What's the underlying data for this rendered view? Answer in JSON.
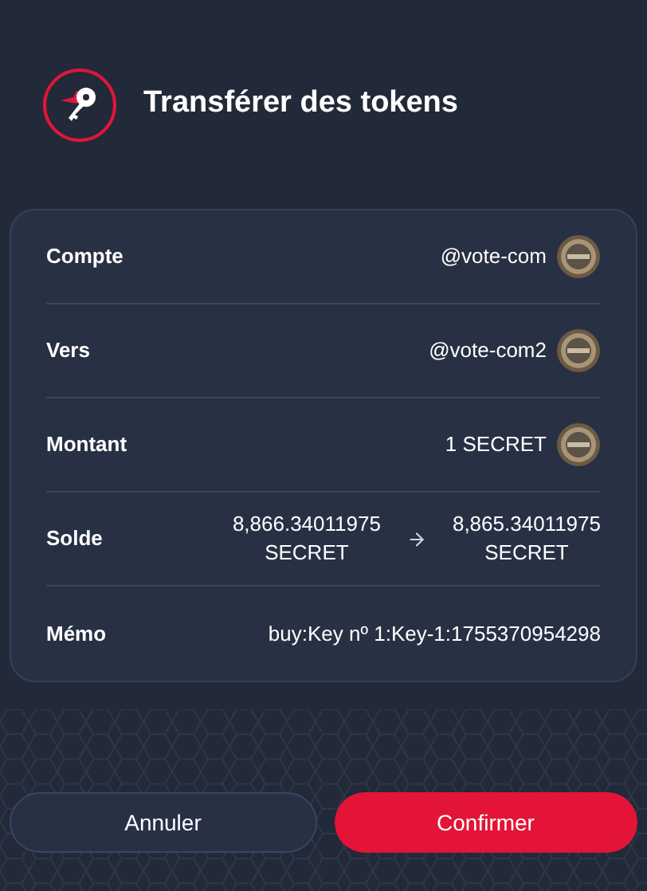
{
  "header": {
    "title": "Transférer des tokens"
  },
  "rows": [
    {
      "kind": "account",
      "label": "Compte",
      "value": "@vote-com"
    },
    {
      "kind": "account",
      "label": "Vers",
      "value": "@vote-com2"
    },
    {
      "kind": "account",
      "label": "Montant",
      "value": "1 SECRET"
    },
    {
      "kind": "balance",
      "label": "Solde",
      "from": {
        "amount": "8,866.34011975",
        "unit": "SECRET"
      },
      "to": {
        "amount": "8,865.34011975",
        "unit": "SECRET"
      }
    },
    {
      "kind": "text",
      "label": "Mémo",
      "value": "buy:Key nº 1:Key-1:1755370954298"
    }
  ],
  "buttons": [
    {
      "kind": "secondary",
      "label": "Annuler"
    },
    {
      "kind": "primary",
      "label": "Confirmer"
    }
  ]
}
